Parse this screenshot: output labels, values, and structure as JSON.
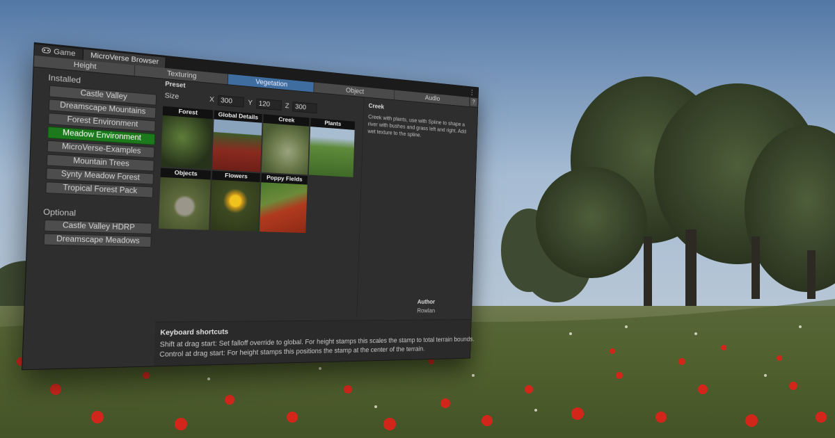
{
  "window": {
    "tabs": [
      {
        "label": "Game",
        "icon": "gamepad-icon"
      },
      {
        "label": "MicroVerse Browser"
      }
    ],
    "menu_icon": "kebab-menu-icon"
  },
  "categories": {
    "items": [
      "Height",
      "Texturing",
      "Vegetation",
      "Object",
      "Audio"
    ],
    "active": "Vegetation",
    "help_label": "?"
  },
  "sidebar": {
    "installed_label": "Installed",
    "installed": [
      "Castle Valley",
      "Dreamscape Mountains",
      "Forest Environment",
      "Meadow Environment",
      "MicroVerse-Examples",
      "Mountain Trees",
      "Synty Meadow Forest",
      "Tropical Forest Pack"
    ],
    "selected": "Meadow Environment",
    "optional_label": "Optional",
    "optional": [
      "Castle Valley HDRP",
      "Dreamscape Meadows"
    ]
  },
  "preset": {
    "label": "Preset",
    "size_label": "Size",
    "x_label": "X",
    "x": "300",
    "y_label": "Y",
    "y": "120",
    "z_label": "Z",
    "z": "300"
  },
  "presets": [
    {
      "name": "Forest"
    },
    {
      "name": "Global Details"
    },
    {
      "name": "Creek",
      "selected": true
    },
    {
      "name": "Plants"
    },
    {
      "name": "Objects"
    },
    {
      "name": "Flowers"
    },
    {
      "name": "Poppy Fields"
    }
  ],
  "details": {
    "title": "Creek",
    "description": "Creek with plants, use with Spline to shape a river with bushes and grass left and right. Add wet texture to the spline.",
    "author_label": "Author",
    "author": "Rowlan"
  },
  "shortcuts": {
    "title": "Keyboard shortcuts",
    "lines": [
      "Shift at drag start: Set falloff override to global. For height stamps this scales the stamp to total terrain bounds.",
      "Control at drag start: For height stamps this positions the stamp at the center of the terrain."
    ]
  },
  "colors": {
    "selected_package": "#1c7a1c",
    "active_category": "#3f6da0"
  }
}
